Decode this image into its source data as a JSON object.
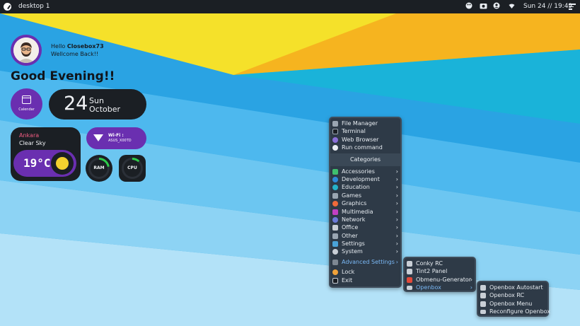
{
  "topbar": {
    "workspace": "desktop 1",
    "clock": "Sun 24 // 19:49",
    "tray_icons": [
      "palette-icon",
      "camera-icon",
      "user-icon",
      "network-icon"
    ]
  },
  "profile": {
    "hello_prefix": "Hello ",
    "username": "Closebox73",
    "welcome": "Wellcome Back!!"
  },
  "greeting": "Good Evening!!",
  "calendar_button": {
    "label": "Calendar"
  },
  "date": {
    "day": "24",
    "weekday": "Sun",
    "month": "October"
  },
  "weather": {
    "city": "Ankara",
    "condition": "Clear Sky",
    "temperature": "19°C"
  },
  "wifi": {
    "label": "Wi-Fi :",
    "ssid": "ASUS_X00TD"
  },
  "gauges": {
    "ram_label": "RAM",
    "cpu_label": "CPU",
    "ram_level": 0.22,
    "cpu_level": 0.12
  },
  "menu_main": {
    "top_items": [
      "File Manager",
      "Terminal",
      "Web Browser",
      "Run command"
    ],
    "categories_header": "Categories",
    "categories": [
      "Accessories",
      "Development",
      "Education",
      "Games",
      "Graphics",
      "Multimedia",
      "Network",
      "Office",
      "Other",
      "Settings",
      "System"
    ],
    "advanced": "Advanced Settings",
    "bottom_items": [
      "Lock",
      "Exit"
    ]
  },
  "menu_advanced": {
    "items": [
      "Conky RC",
      "Tint2 Panel",
      "Obmenu-Generator",
      "Openbox"
    ]
  },
  "menu_openbox": {
    "items": [
      "Openbox Autostart",
      "Openbox RC",
      "Openbox Menu",
      "Reconfigure Openbox"
    ]
  },
  "colors": {
    "accent_purple": "#6a2fb0",
    "panel_dark": "#1b1f24",
    "menu_bg": "#2e3a47",
    "highlight": "#7ab8f5",
    "gauge_green": "#2ecc4a",
    "sun_yellow": "#f3d12f",
    "city_pink": "#f35c82"
  }
}
